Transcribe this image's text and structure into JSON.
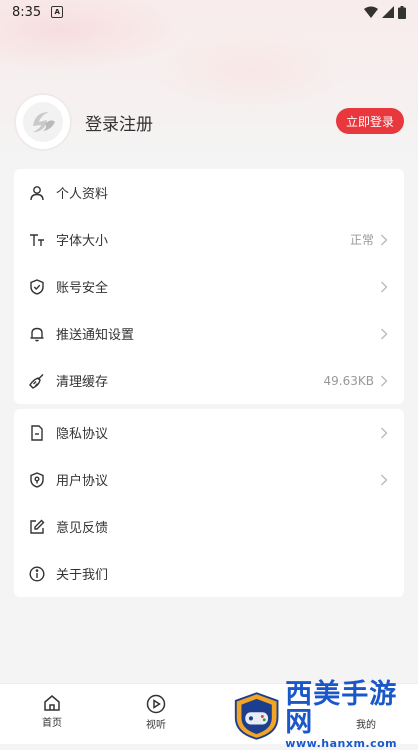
{
  "status_bar": {
    "time": "8:35",
    "notification_letter": "A"
  },
  "profile": {
    "login_prompt": "登录注册",
    "login_button": "立即登录"
  },
  "settings_group1": [
    {
      "icon": "person-icon",
      "label": "个人资料",
      "value": ""
    },
    {
      "icon": "font-size-icon",
      "label": "字体大小",
      "value": "正常"
    },
    {
      "icon": "shield-icon",
      "label": "账号安全",
      "value": ""
    },
    {
      "icon": "bell-icon",
      "label": "推送通知设置",
      "value": ""
    },
    {
      "icon": "broom-icon",
      "label": "清理缓存",
      "value": "49.63KB"
    }
  ],
  "settings_group2": [
    {
      "icon": "document-icon",
      "label": "隐私协议"
    },
    {
      "icon": "user-shield-icon",
      "label": "用户协议"
    },
    {
      "icon": "edit-icon",
      "label": "意见反馈"
    },
    {
      "icon": "info-icon",
      "label": "关于我们"
    }
  ],
  "tabbar": {
    "home_label": "首页",
    "video_label": "视听",
    "mine_label": "我的"
  },
  "watermark": {
    "title": "西美手游网",
    "url": "www.hanxm.com"
  },
  "colors": {
    "accent": "#e8383d",
    "watermark_blue": "#1a58c9"
  }
}
